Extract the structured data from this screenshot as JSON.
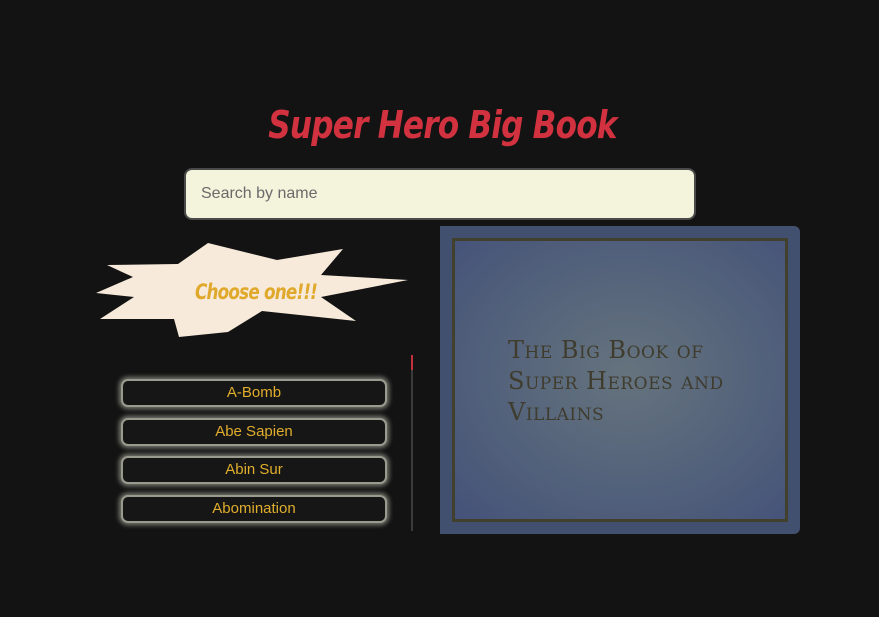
{
  "app": {
    "title": "Super Hero Big Book"
  },
  "search": {
    "placeholder": "Search by name",
    "value": ""
  },
  "picker": {
    "prompt": "Choose one!!!",
    "items": [
      {
        "label": "A-Bomb"
      },
      {
        "label": "Abe Sapien"
      },
      {
        "label": "Abin Sur"
      },
      {
        "label": "Abomination"
      }
    ]
  },
  "book": {
    "title": "The Big Book of Super Heroes and Villains"
  },
  "colors": {
    "background": "#131313",
    "title_red": "#d2323f",
    "gold": "#e0ad2c",
    "search_bg": "#f4f3dc",
    "burst_bg": "#f7eadb",
    "book_blue": "#41506e",
    "scroll_thumb": "#c2323c"
  }
}
